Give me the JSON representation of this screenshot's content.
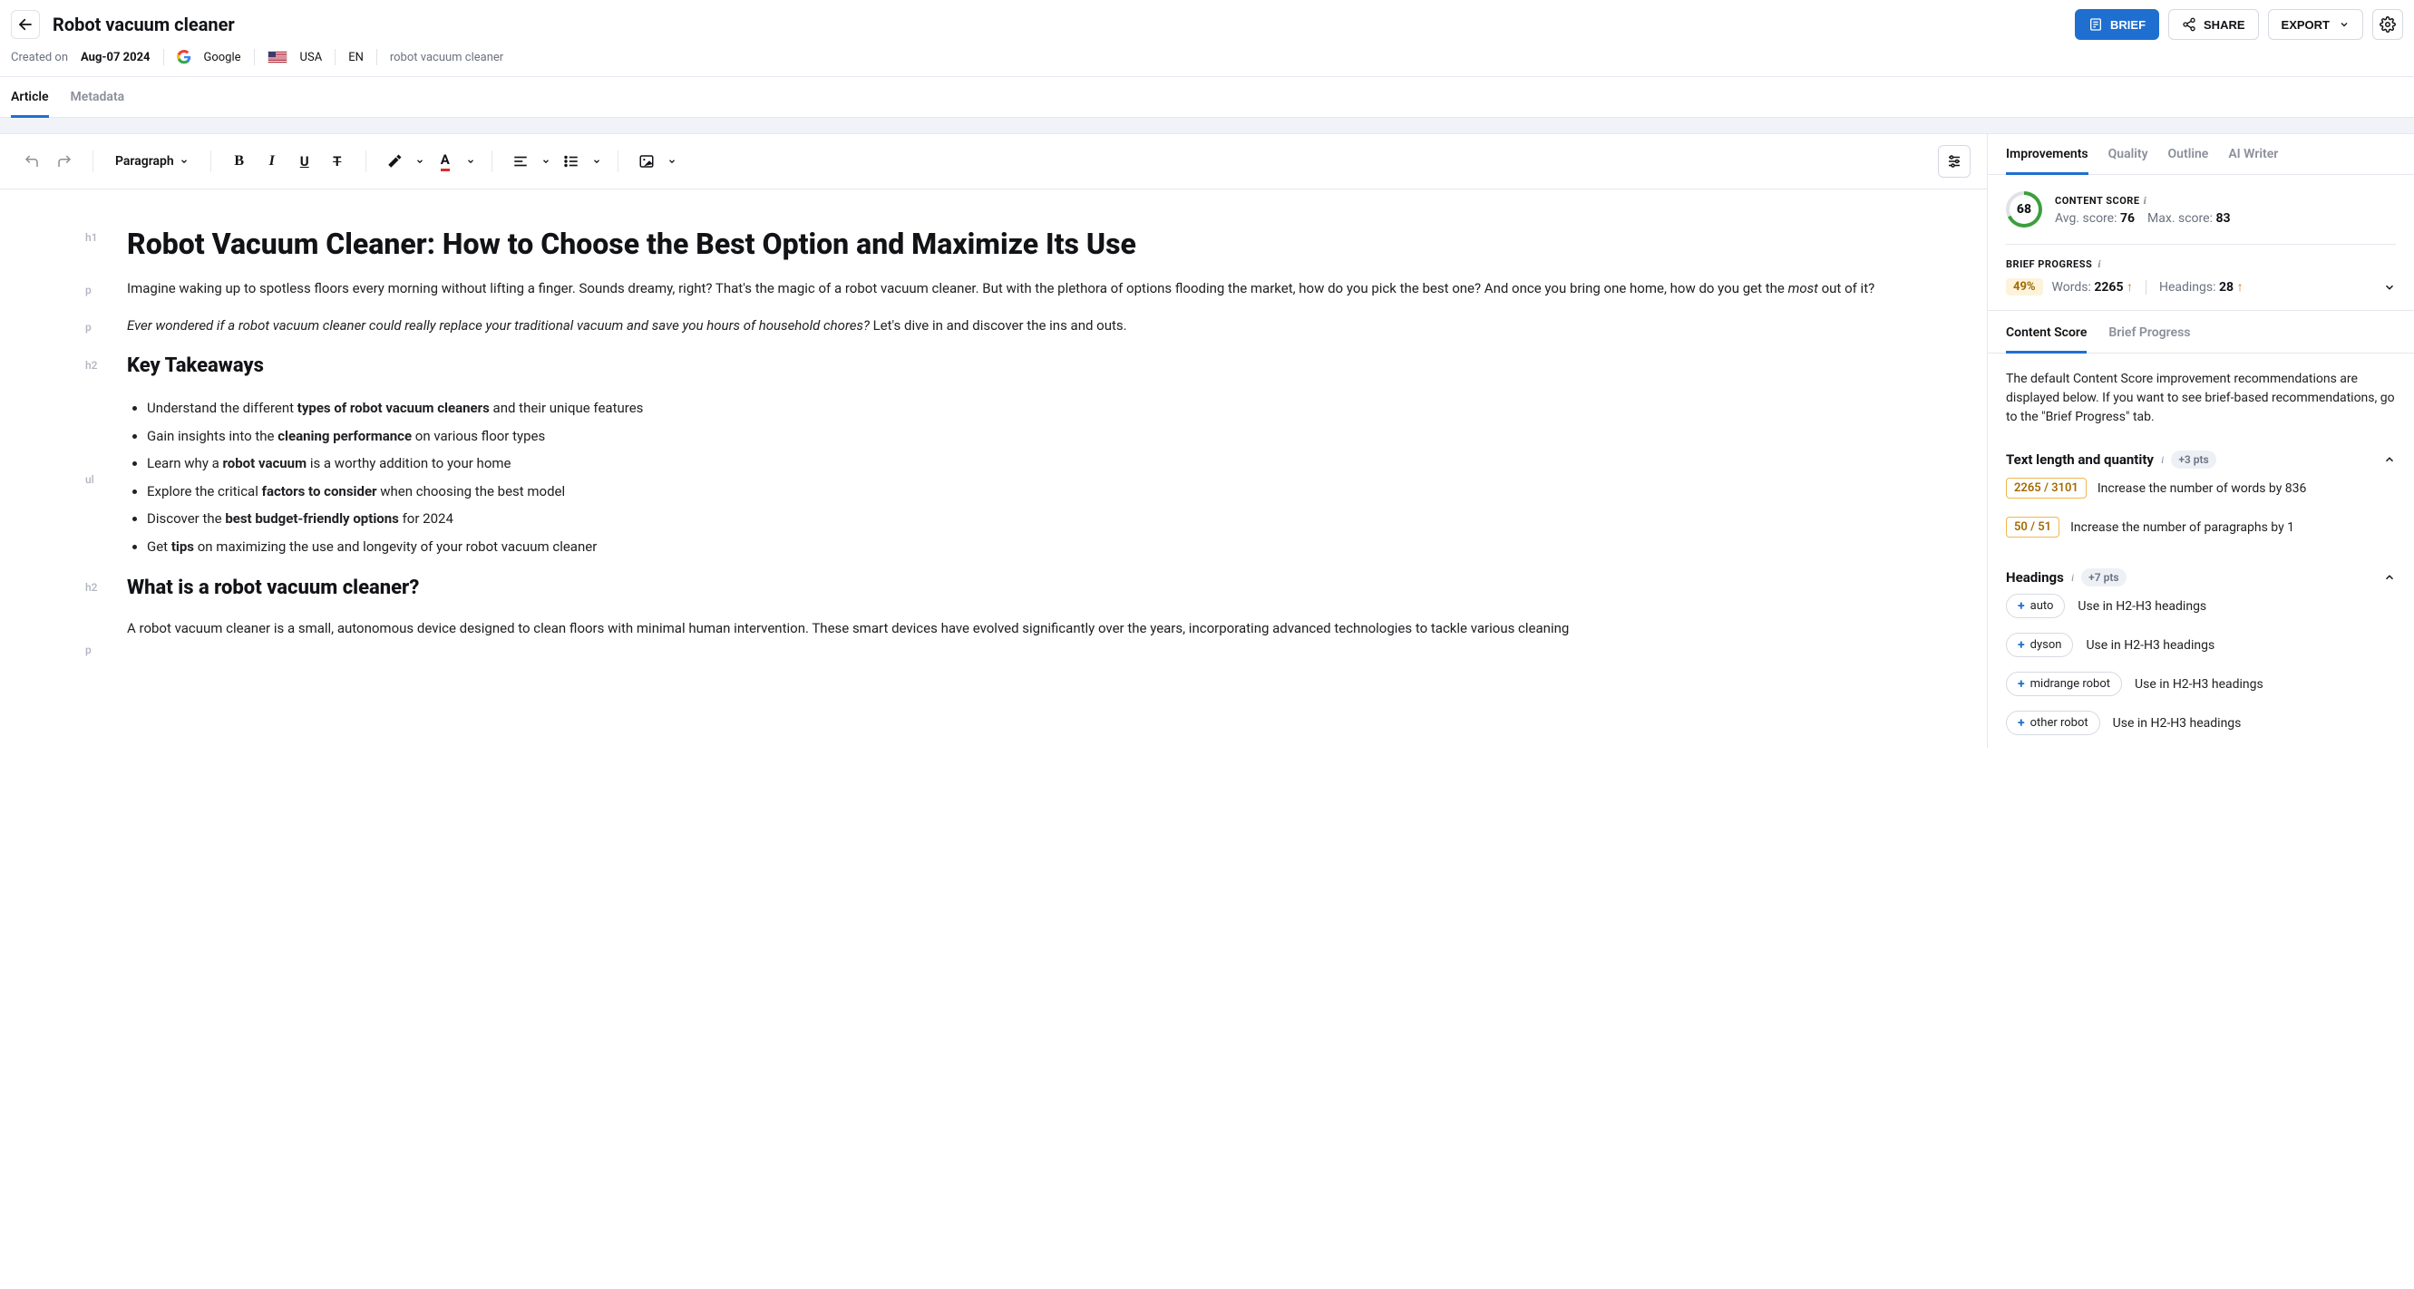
{
  "header": {
    "title": "Robot vacuum cleaner",
    "brief_button": "BRIEF",
    "share_button": "SHARE",
    "export_button": "EXPORT"
  },
  "meta": {
    "created_label": "Created on",
    "created_date": "Aug-07 2024",
    "search_engine": "Google",
    "country": "USA",
    "lang": "EN",
    "keyword": "robot vacuum cleaner"
  },
  "page_tabs": {
    "article": "Article",
    "metadata": "Metadata"
  },
  "toolbar": {
    "paragraph_label": "Paragraph"
  },
  "article": {
    "h1": "Robot Vacuum Cleaner: How to Choose the Best Option and Maximize Its Use",
    "p1_a": "Imagine waking up to spotless floors every morning without lifting a finger. Sounds dreamy, right? That's the magic of a robot vacuum cleaner. But with the plethora of options flooding the market, how do you pick the best one? And once you bring one home, how do you get the ",
    "p1_em": "most",
    "p1_b": " out of it?",
    "p2_em": "Ever wondered if a robot vacuum cleaner could really replace your traditional vacuum and save you hours of household chores?",
    "p2_b": " Let's dive in and discover the ins and outs.",
    "h2_1": "Key Takeaways",
    "li1_a": "Understand the different ",
    "li1_b": "types of robot vacuum cleaners",
    "li1_c": " and their unique features",
    "li2_a": "Gain insights into the ",
    "li2_b": "cleaning performance",
    "li2_c": " on various floor types",
    "li3_a": "Learn why a ",
    "li3_b": "robot vacuum",
    "li3_c": " is a worthy addition to your home",
    "li4_a": "Explore the critical ",
    "li4_b": "factors to consider",
    "li4_c": " when choosing the best model",
    "li5_a": "Discover the ",
    "li5_b": "best budget-friendly options",
    "li5_c": " for 2024",
    "li6_a": "Get ",
    "li6_b": "tips",
    "li6_c": " on maximizing the use and longevity of your robot vacuum cleaner",
    "h2_2": "What is a robot vacuum cleaner?",
    "p3": "A robot vacuum cleaner is a small, autonomous device designed to clean floors with minimal human intervention. These smart devices have evolved significantly over the years, incorporating advanced technologies to tackle various cleaning"
  },
  "aside": {
    "tabs": {
      "improvements": "Improvements",
      "quality": "Quality",
      "outline": "Outline",
      "ai_writer": "AI Writer"
    },
    "score": {
      "title": "CONTENT SCORE",
      "value": "68",
      "avg_label": "Avg. score:",
      "avg_value": "76",
      "max_label": "Max. score:",
      "max_value": "83"
    },
    "brief": {
      "title": "BRIEF PROGRESS",
      "percent": "49%",
      "words_label": "Words:",
      "words_value": "2265",
      "headings_label": "Headings:",
      "headings_value": "28"
    },
    "sub_tabs": {
      "content_score": "Content Score",
      "brief_progress": "Brief Progress"
    },
    "info_text": "The default Content Score improvement recommendations are displayed below. If you want to see brief-based recommendations, go to the \"Brief Progress\" tab.",
    "section_text": {
      "title": "Text length and quantity",
      "pts": "+3 pts",
      "rec1_pill": "2265 / 3101",
      "rec1_text": "Increase the number of words by 836",
      "rec2_pill": "50 / 51",
      "rec2_text": "Increase the number of paragraphs by 1"
    },
    "section_headings": {
      "title": "Headings",
      "pts": "+7 pts",
      "kw1": "auto",
      "kw2": "dyson",
      "kw3": "midrange robot",
      "kw4": "other robot",
      "hint": "Use in H2-H3 headings"
    }
  }
}
